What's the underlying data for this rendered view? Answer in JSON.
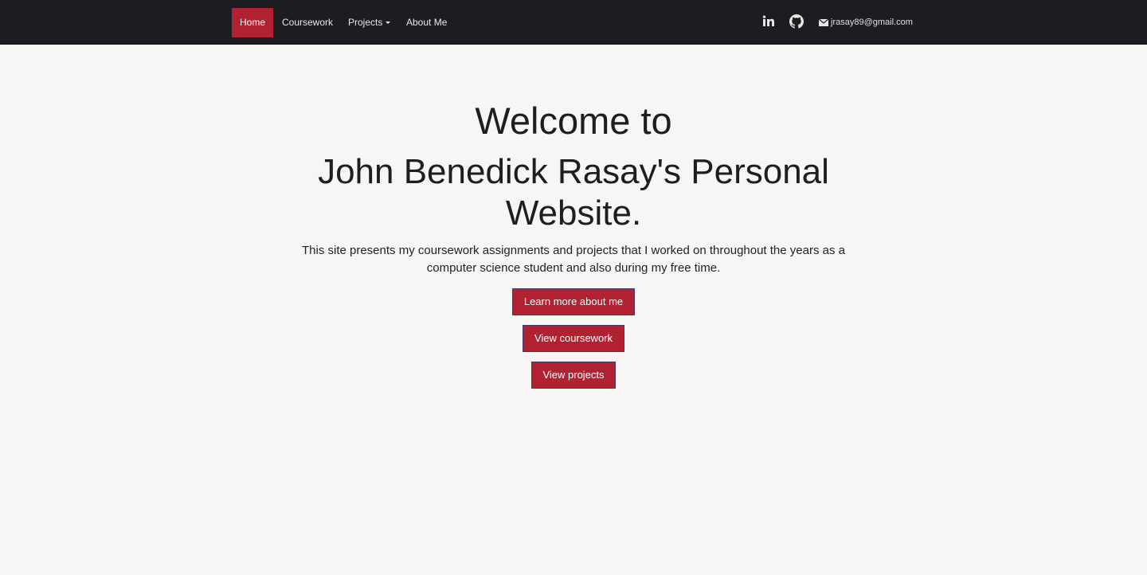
{
  "navbar": {
    "items": [
      {
        "label": "Home",
        "active": true
      },
      {
        "label": "Coursework",
        "active": false
      },
      {
        "label": "Projects",
        "active": false,
        "has_dropdown": true
      },
      {
        "label": "About Me",
        "active": false
      }
    ],
    "social": {
      "linkedin_icon": "linkedin-icon",
      "github_icon": "github-icon",
      "email_icon": "envelope-icon",
      "email": "jrasay89@gmail.com"
    }
  },
  "hero": {
    "title_line1": "Welcome to",
    "title_line2": "John Benedick Rasay's Personal Website.",
    "description": "This site presents my coursework assignments and projects that I worked on throughout the years as a computer science student and also during my free time.",
    "buttons": {
      "learn_more": "Learn more about me",
      "view_coursework": "View coursework",
      "view_projects": "View projects"
    }
  },
  "colors": {
    "navbar_bg": "#1b1d20",
    "accent": "#b02231",
    "page_bg": "#f7f6f4"
  }
}
